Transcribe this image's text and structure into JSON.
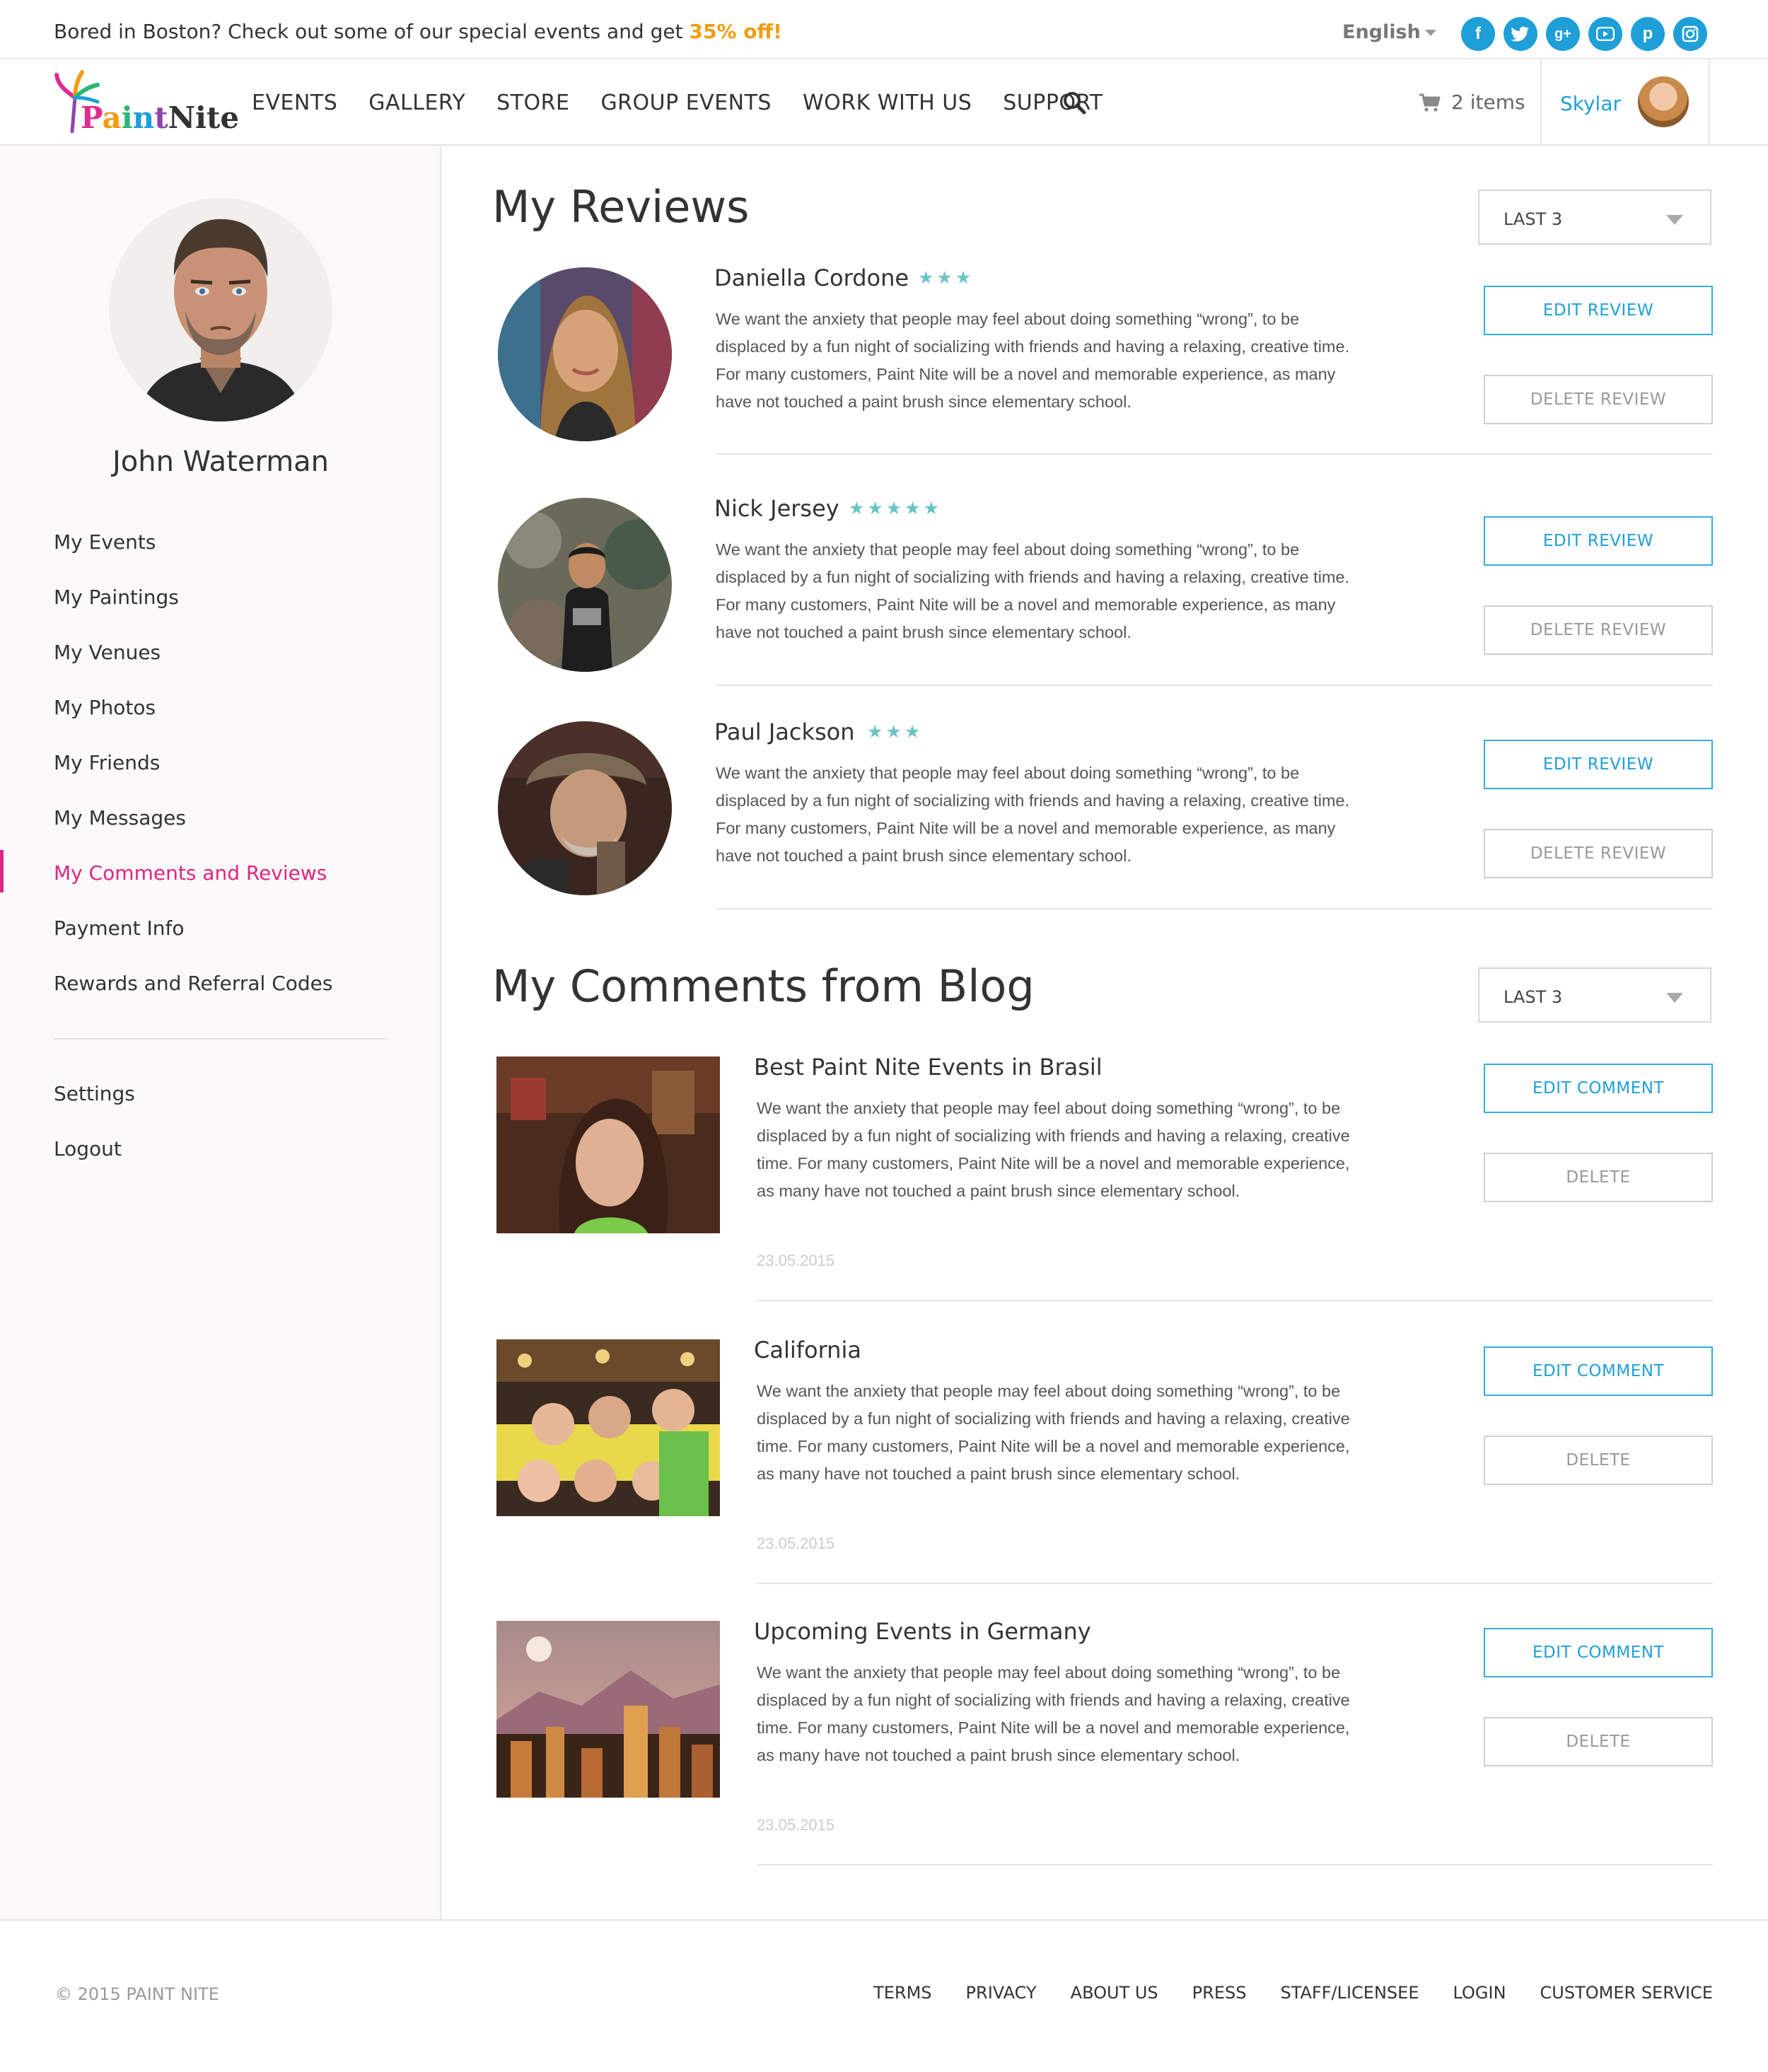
{
  "topbar": {
    "promo_text": "Bored in Boston? Check out some of our special events and get ",
    "promo_highlight": "35% off!",
    "language": "English"
  },
  "socials": [
    "facebook-icon",
    "twitter-icon",
    "google-plus-icon",
    "youtube-icon",
    "pinterest-icon",
    "instagram-icon"
  ],
  "header": {
    "logo_text": "PaintNite",
    "nav": [
      "EVENTS",
      "GALLERY",
      "STORE",
      "GROUP EVENTS",
      "WORK WITH US",
      "SUPPORT"
    ],
    "cart_count": "2 items",
    "user_name": "Skylar"
  },
  "sidebar": {
    "profile_name": "John Waterman",
    "menu": [
      "My Events",
      "My Paintings",
      "My Venues",
      "My Photos",
      "My Friends",
      "My Messages",
      "My Comments and Reviews",
      "Payment Info",
      "Rewards and Referral Codes"
    ],
    "active_item": "My Comments and Reviews",
    "secondary": [
      "Settings",
      "Logout"
    ]
  },
  "reviews": {
    "title": "My Reviews",
    "filter": "LAST 3",
    "edit_label": "EDIT REVIEW",
    "delete_label": "DELETE REVIEW",
    "items": [
      {
        "name": "Daniella Cordone",
        "rating": 3,
        "text": "We want the anxiety that people may feel about doing something “wrong”, to be displaced by a fun night of socializing with friends and having a relaxing, creative time. For many customers, Paint Nite will be a novel and memorable experience, as many have not touched a paint brush since elementary school."
      },
      {
        "name": "Nick Jersey",
        "rating": 5,
        "text": "We want the anxiety that people may feel about doing something “wrong”, to be displaced by a fun night of socializing with friends and having a relaxing, creative time. For many customers, Paint Nite will be a novel and memorable experience, as many have not touched a paint brush since elementary school."
      },
      {
        "name": "Paul Jackson",
        "rating": 3,
        "text": "We want the anxiety that people may feel about doing something “wrong”, to be displaced by a fun night of socializing with friends and having a relaxing, creative time. For many customers, Paint Nite will be a novel and memorable experience, as many have not touched a paint brush since elementary school."
      }
    ]
  },
  "comments": {
    "title": "My Comments from Blog",
    "filter": "LAST 3",
    "edit_label": "EDIT COMMENT",
    "delete_label": "DELETE",
    "items": [
      {
        "title": "Best Paint Nite Events in Brasil",
        "text": "We want the anxiety that people may feel about doing something “wrong”, to be displaced by a fun night of socializing with friends and having a relaxing, creative time. For many customers, Paint Nite will be a novel and memorable experience, as many have not touched a paint brush since elementary school.",
        "date": "23.05.2015"
      },
      {
        "title": "California",
        "text": "We want the anxiety that people may feel about doing something “wrong”, to be displaced by a fun night of socializing with friends and having a relaxing, creative time. For many customers, Paint Nite will be a novel and memorable experience, as many have not touched a paint brush since elementary school.",
        "date": "23.05.2015"
      },
      {
        "title": "Upcoming Events in Germany",
        "text": "We want the anxiety that people may feel about doing something “wrong”, to be displaced by a fun night of socializing with friends and having a relaxing, creative time. For many customers, Paint Nite will be a novel and memorable experience, as many have not touched a paint brush since elementary school.",
        "date": "23.05.2015"
      }
    ]
  },
  "footer": {
    "copyright": "© 2015 PAINT NITE",
    "links": [
      "TERMS",
      "PRIVACY",
      "ABOUT US",
      "PRESS",
      "STAFF/LICENSEE",
      "LOGIN",
      "CUSTOMER SERVICE"
    ]
  },
  "colors": {
    "accent_blue": "#1e9fd8",
    "accent_pink": "#e0267f",
    "promo_orange": "#f39c12",
    "star_teal": "#6cc4c4"
  }
}
